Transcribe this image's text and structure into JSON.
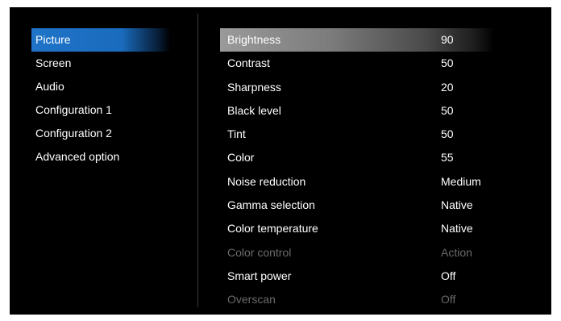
{
  "left_menu": {
    "items": [
      {
        "label": "Picture",
        "selected": true
      },
      {
        "label": "Screen"
      },
      {
        "label": "Audio"
      },
      {
        "label": "Configuration 1"
      },
      {
        "label": "Configuration 2"
      },
      {
        "label": "Advanced option"
      }
    ]
  },
  "settings": {
    "rows": [
      {
        "label": "Brightness",
        "value": "90"
      },
      {
        "label": "Contrast",
        "value": "50"
      },
      {
        "label": "Sharpness",
        "value": "20"
      },
      {
        "label": "Black level",
        "value": "50"
      },
      {
        "label": "Tint",
        "value": "50"
      },
      {
        "label": "Color",
        "value": "55"
      },
      {
        "label": "Noise reduction",
        "value": "Medium"
      },
      {
        "label": "Gamma selection",
        "value": "Native"
      },
      {
        "label": "Color temperature",
        "value": "Native"
      },
      {
        "label": "Color control",
        "value": "Action"
      },
      {
        "label": "Smart power",
        "value": "Off"
      },
      {
        "label": "Overscan",
        "value": "Off"
      }
    ]
  },
  "colors": {
    "background": "#000000",
    "text": "#ffffff",
    "selected_left": "#1f74c8",
    "selected_row": "#9a9a9a",
    "disabled_text": "#6a6a6a"
  }
}
